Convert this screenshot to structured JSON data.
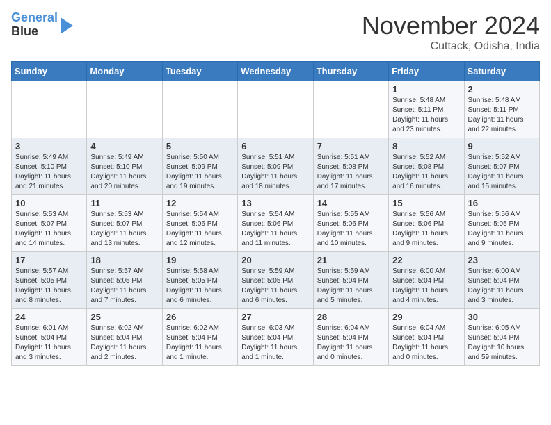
{
  "header": {
    "logo_line1": "General",
    "logo_line2": "Blue",
    "month": "November 2024",
    "location": "Cuttack, Odisha, India"
  },
  "days_of_week": [
    "Sunday",
    "Monday",
    "Tuesday",
    "Wednesday",
    "Thursday",
    "Friday",
    "Saturday"
  ],
  "weeks": [
    [
      {
        "day": "",
        "info": ""
      },
      {
        "day": "",
        "info": ""
      },
      {
        "day": "",
        "info": ""
      },
      {
        "day": "",
        "info": ""
      },
      {
        "day": "",
        "info": ""
      },
      {
        "day": "1",
        "info": "Sunrise: 5:48 AM\nSunset: 5:11 PM\nDaylight: 11 hours and 23 minutes."
      },
      {
        "day": "2",
        "info": "Sunrise: 5:48 AM\nSunset: 5:11 PM\nDaylight: 11 hours and 22 minutes."
      }
    ],
    [
      {
        "day": "3",
        "info": "Sunrise: 5:49 AM\nSunset: 5:10 PM\nDaylight: 11 hours and 21 minutes."
      },
      {
        "day": "4",
        "info": "Sunrise: 5:49 AM\nSunset: 5:10 PM\nDaylight: 11 hours and 20 minutes."
      },
      {
        "day": "5",
        "info": "Sunrise: 5:50 AM\nSunset: 5:09 PM\nDaylight: 11 hours and 19 minutes."
      },
      {
        "day": "6",
        "info": "Sunrise: 5:51 AM\nSunset: 5:09 PM\nDaylight: 11 hours and 18 minutes."
      },
      {
        "day": "7",
        "info": "Sunrise: 5:51 AM\nSunset: 5:08 PM\nDaylight: 11 hours and 17 minutes."
      },
      {
        "day": "8",
        "info": "Sunrise: 5:52 AM\nSunset: 5:08 PM\nDaylight: 11 hours and 16 minutes."
      },
      {
        "day": "9",
        "info": "Sunrise: 5:52 AM\nSunset: 5:07 PM\nDaylight: 11 hours and 15 minutes."
      }
    ],
    [
      {
        "day": "10",
        "info": "Sunrise: 5:53 AM\nSunset: 5:07 PM\nDaylight: 11 hours and 14 minutes."
      },
      {
        "day": "11",
        "info": "Sunrise: 5:53 AM\nSunset: 5:07 PM\nDaylight: 11 hours and 13 minutes."
      },
      {
        "day": "12",
        "info": "Sunrise: 5:54 AM\nSunset: 5:06 PM\nDaylight: 11 hours and 12 minutes."
      },
      {
        "day": "13",
        "info": "Sunrise: 5:54 AM\nSunset: 5:06 PM\nDaylight: 11 hours and 11 minutes."
      },
      {
        "day": "14",
        "info": "Sunrise: 5:55 AM\nSunset: 5:06 PM\nDaylight: 11 hours and 10 minutes."
      },
      {
        "day": "15",
        "info": "Sunrise: 5:56 AM\nSunset: 5:06 PM\nDaylight: 11 hours and 9 minutes."
      },
      {
        "day": "16",
        "info": "Sunrise: 5:56 AM\nSunset: 5:05 PM\nDaylight: 11 hours and 9 minutes."
      }
    ],
    [
      {
        "day": "17",
        "info": "Sunrise: 5:57 AM\nSunset: 5:05 PM\nDaylight: 11 hours and 8 minutes."
      },
      {
        "day": "18",
        "info": "Sunrise: 5:57 AM\nSunset: 5:05 PM\nDaylight: 11 hours and 7 minutes."
      },
      {
        "day": "19",
        "info": "Sunrise: 5:58 AM\nSunset: 5:05 PM\nDaylight: 11 hours and 6 minutes."
      },
      {
        "day": "20",
        "info": "Sunrise: 5:59 AM\nSunset: 5:05 PM\nDaylight: 11 hours and 6 minutes."
      },
      {
        "day": "21",
        "info": "Sunrise: 5:59 AM\nSunset: 5:04 PM\nDaylight: 11 hours and 5 minutes."
      },
      {
        "day": "22",
        "info": "Sunrise: 6:00 AM\nSunset: 5:04 PM\nDaylight: 11 hours and 4 minutes."
      },
      {
        "day": "23",
        "info": "Sunrise: 6:00 AM\nSunset: 5:04 PM\nDaylight: 11 hours and 3 minutes."
      }
    ],
    [
      {
        "day": "24",
        "info": "Sunrise: 6:01 AM\nSunset: 5:04 PM\nDaylight: 11 hours and 3 minutes."
      },
      {
        "day": "25",
        "info": "Sunrise: 6:02 AM\nSunset: 5:04 PM\nDaylight: 11 hours and 2 minutes."
      },
      {
        "day": "26",
        "info": "Sunrise: 6:02 AM\nSunset: 5:04 PM\nDaylight: 11 hours and 1 minute."
      },
      {
        "day": "27",
        "info": "Sunrise: 6:03 AM\nSunset: 5:04 PM\nDaylight: 11 hours and 1 minute."
      },
      {
        "day": "28",
        "info": "Sunrise: 6:04 AM\nSunset: 5:04 PM\nDaylight: 11 hours and 0 minutes."
      },
      {
        "day": "29",
        "info": "Sunrise: 6:04 AM\nSunset: 5:04 PM\nDaylight: 11 hours and 0 minutes."
      },
      {
        "day": "30",
        "info": "Sunrise: 6:05 AM\nSunset: 5:04 PM\nDaylight: 10 hours and 59 minutes."
      }
    ]
  ]
}
